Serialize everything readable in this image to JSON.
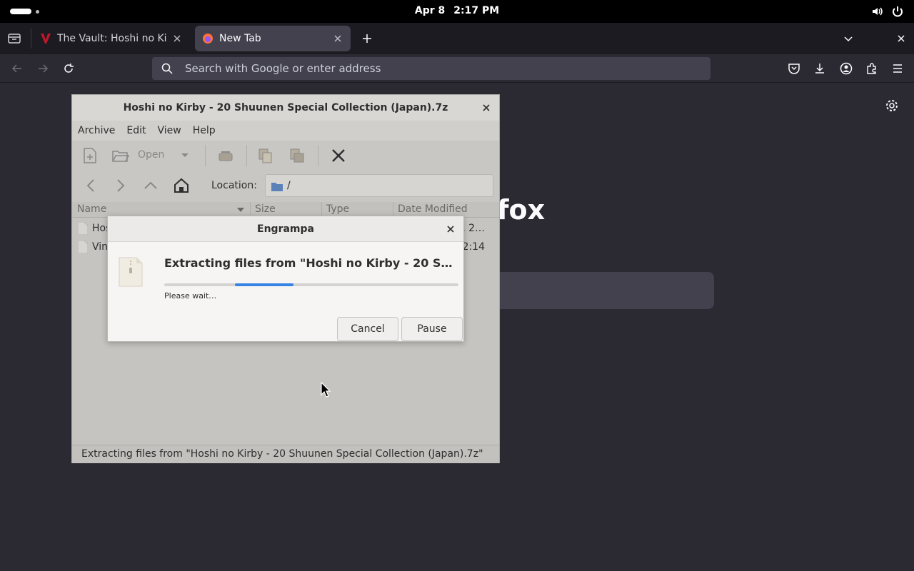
{
  "topbar": {
    "date": "Apr 8",
    "time": "2:17 PM"
  },
  "browser": {
    "tabs": [
      {
        "title": "The Vault: Hoshi no Kirby",
        "active": false
      },
      {
        "title": "New Tab",
        "active": true
      }
    ],
    "urlbar_placeholder": "Search with Google or enter address",
    "newtab_wordmark": "fox"
  },
  "engrampa": {
    "window_title": "Hoshi no Kirby - 20 Shuunen Special Collection (Japan).7z",
    "menu": [
      "Archive",
      "Edit",
      "View",
      "Help"
    ],
    "toolbar": {
      "open_label": "Open"
    },
    "location_label": "Location:",
    "location_path": "/",
    "columns": [
      "Name",
      "Size",
      "Type",
      "Date Modified"
    ],
    "rows": [
      {
        "name": "Hos",
        "date": "7, 2…"
      },
      {
        "name": "Vin",
        "date": "2:14"
      }
    ],
    "status": "Extracting files from \"Hoshi no Kirby - 20 Shuunen Special Collection (Japan).7z\""
  },
  "dialog": {
    "title": "Engrampa",
    "message": "Extracting files from \"Hoshi no Kirby - 20 Shuunen Special Collection (Japan).7z\"",
    "subtext": "Please wait…",
    "progress_start": 0.24,
    "progress_end": 0.44,
    "cancel_label": "Cancel",
    "pause_label": "Pause"
  },
  "colors": {
    "accent": "#3584e4",
    "vault_favicon": "#c0172d"
  }
}
